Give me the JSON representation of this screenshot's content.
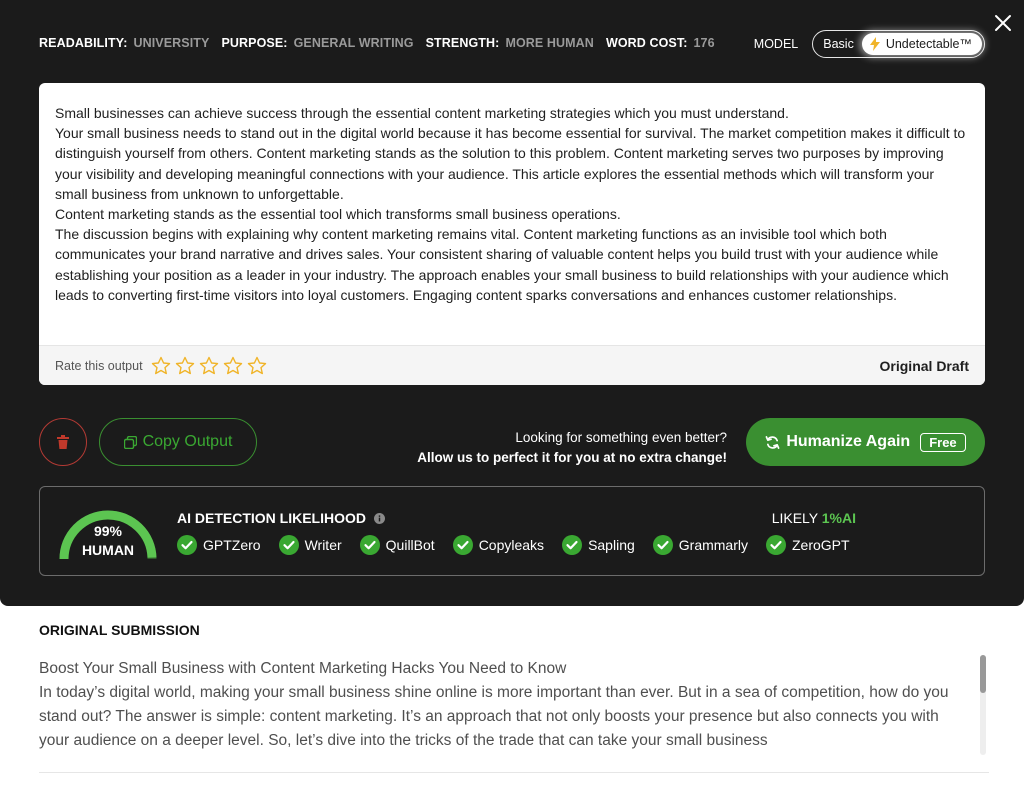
{
  "settings": {
    "readability_label": "READABILITY:",
    "readability_value": "UNIVERSITY",
    "purpose_label": "PURPOSE:",
    "purpose_value": "GENERAL WRITING",
    "strength_label": "STRENGTH:",
    "strength_value": "MORE HUMAN",
    "word_cost_label": "WORD COST:",
    "word_cost_value": "176"
  },
  "model": {
    "label": "MODEL",
    "options": [
      "Basic",
      "Undetectable™"
    ],
    "selected": "Undetectable™"
  },
  "output": {
    "paragraphs": [
      "Small businesses can achieve success through the essential content marketing strategies which you must understand.",
      "Your small business needs to stand out in the digital world because it has become essential for survival. The market competition makes it difficult to distinguish yourself from others. Content marketing stands as the solution to this problem. Content marketing serves two purposes by improving your visibility and developing meaningful connections with your audience. This article explores the essential methods which will transform your small business from unknown to unforgettable.",
      "Content marketing stands as the essential tool which transforms small business operations.",
      "The discussion begins with explaining why content marketing remains vital. Content marketing functions as an invisible tool which both communicates your brand narrative and drives sales. Your consistent sharing of valuable content helps you build trust with your audience while establishing your position as a leader in your industry. The approach enables your small business to build relationships with your audience which leads to converting first-time visitors into loyal customers. Engaging content sparks conversations and enhances customer relationships."
    ],
    "rate_label": "Rate this output",
    "rating": 0,
    "rating_max": 5,
    "draft_label": "Original Draft"
  },
  "actions": {
    "copy_label": "Copy Output",
    "promo_line1": "Looking for something even better?",
    "promo_line2": "Allow us to perfect it for you at no extra change!",
    "humanize_label": "Humanize Again",
    "free_badge": "Free"
  },
  "detection": {
    "score_text": "99%",
    "score_label": "HUMAN",
    "score_value": 99,
    "title": "AI DETECTION LIKELIHOOD",
    "likely_label": "LIKELY",
    "likely_value": "1%AI",
    "detectors": [
      "GPTZero",
      "Writer",
      "QuillBot",
      "Copyleaks",
      "Sapling",
      "Grammarly",
      "ZeroGPT"
    ]
  },
  "original": {
    "title": "ORIGINAL SUBMISSION",
    "paragraphs": [
      "Boost Your Small Business with Content Marketing Hacks You Need to Know",
      "In today’s digital world, making your small business shine online is more important than ever. But in a sea of competition, how do you stand out? The answer is simple: content marketing. It’s an approach that not only boosts your presence but also connects you with your audience on a deeper level. So, let’s dive into the tricks of the trade that can take your small business"
    ]
  },
  "colors": {
    "panel_bg": "#1b1b1b",
    "accent_green": "#3a8f31",
    "likely_green": "#5cc551",
    "delete_red": "#b33a34",
    "star_gold": "#f0b429"
  }
}
